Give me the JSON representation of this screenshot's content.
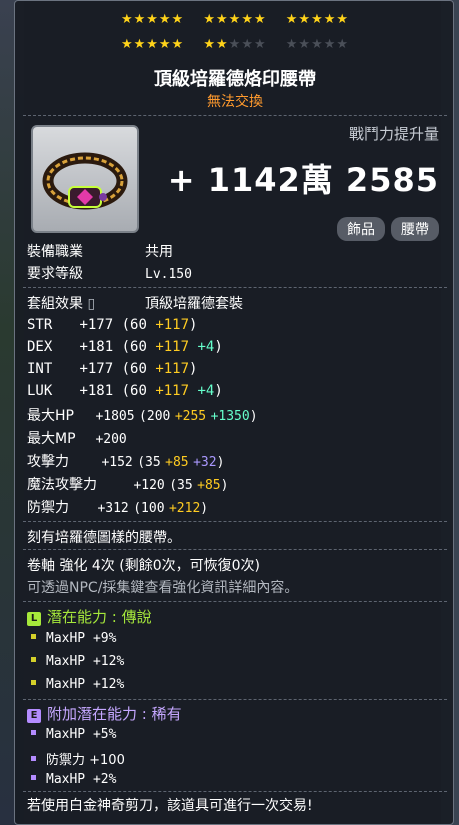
{
  "stars": {
    "row1_filled": 15,
    "row2_filled": 7,
    "total_per_row": 15
  },
  "item": {
    "name": "頂級培羅德烙印腰帶",
    "trade": "無法交換"
  },
  "power": {
    "label": "戰鬥力提升量",
    "value": "+ 1142萬 2585"
  },
  "tags": [
    "飾品",
    "腰帶"
  ],
  "info": {
    "job_label": "裝備職業",
    "job_value": "共用",
    "level_label": "要求等級",
    "level_value": "Lv.150",
    "set_label": "套組效果",
    "set_value": "頂級培羅德套裝"
  },
  "stats": [
    {
      "name": "STR",
      "total": "+177",
      "base": "(60",
      "bonus": "+117",
      "extra": "",
      "close": ")"
    },
    {
      "name": "DEX",
      "total": "+181",
      "base": "(60",
      "bonus": "+117",
      "extra": "+4",
      "close": ")"
    },
    {
      "name": "INT",
      "total": "+177",
      "base": "(60",
      "bonus": "+117",
      "extra": "",
      "close": ")"
    },
    {
      "name": "LUK",
      "total": "+181",
      "base": "(60",
      "bonus": "+117",
      "extra": "+4",
      "close": ")"
    },
    {
      "name": "最大HP",
      "total": "+1805",
      "base": "(200",
      "bonus": "+255",
      "extra": "+1350",
      "close": ")"
    },
    {
      "name": "最大MP",
      "total": "+200",
      "base": "",
      "bonus": "",
      "extra": "",
      "close": ""
    },
    {
      "name": "攻擊力",
      "total": "+152",
      "base": "(35",
      "bonus": "+85",
      "extra": "+32",
      "close": ")"
    },
    {
      "name": "魔法攻擊力",
      "total": "+120",
      "base": "(35",
      "bonus": "+85",
      "extra": "",
      "close": ")"
    },
    {
      "name": "防禦力",
      "total": "+312",
      "base": "(100",
      "bonus": "+212",
      "extra": "",
      "close": ")"
    }
  ],
  "description": "刻有培羅德圖樣的腰帶。",
  "scroll": {
    "line": "卷軸 強化 4次 (剩餘0次，可恢復0次)",
    "hint": "可透過NPC/採集鍵查看強化資訊詳細內容。"
  },
  "potential": {
    "label": "潛在能力 : 傳說",
    "badge": "L",
    "lines": [
      "MaxHP +9%",
      "MaxHP +12%",
      "MaxHP +12%"
    ]
  },
  "bonus_potential": {
    "label": "附加潛在能力 : 稀有",
    "badge": "E",
    "lines": [
      "MaxHP +5%",
      "防禦力 +100",
      "MaxHP +2%"
    ]
  },
  "footer": "若使用白金神奇剪刀，該道具可進行一次交易!"
}
